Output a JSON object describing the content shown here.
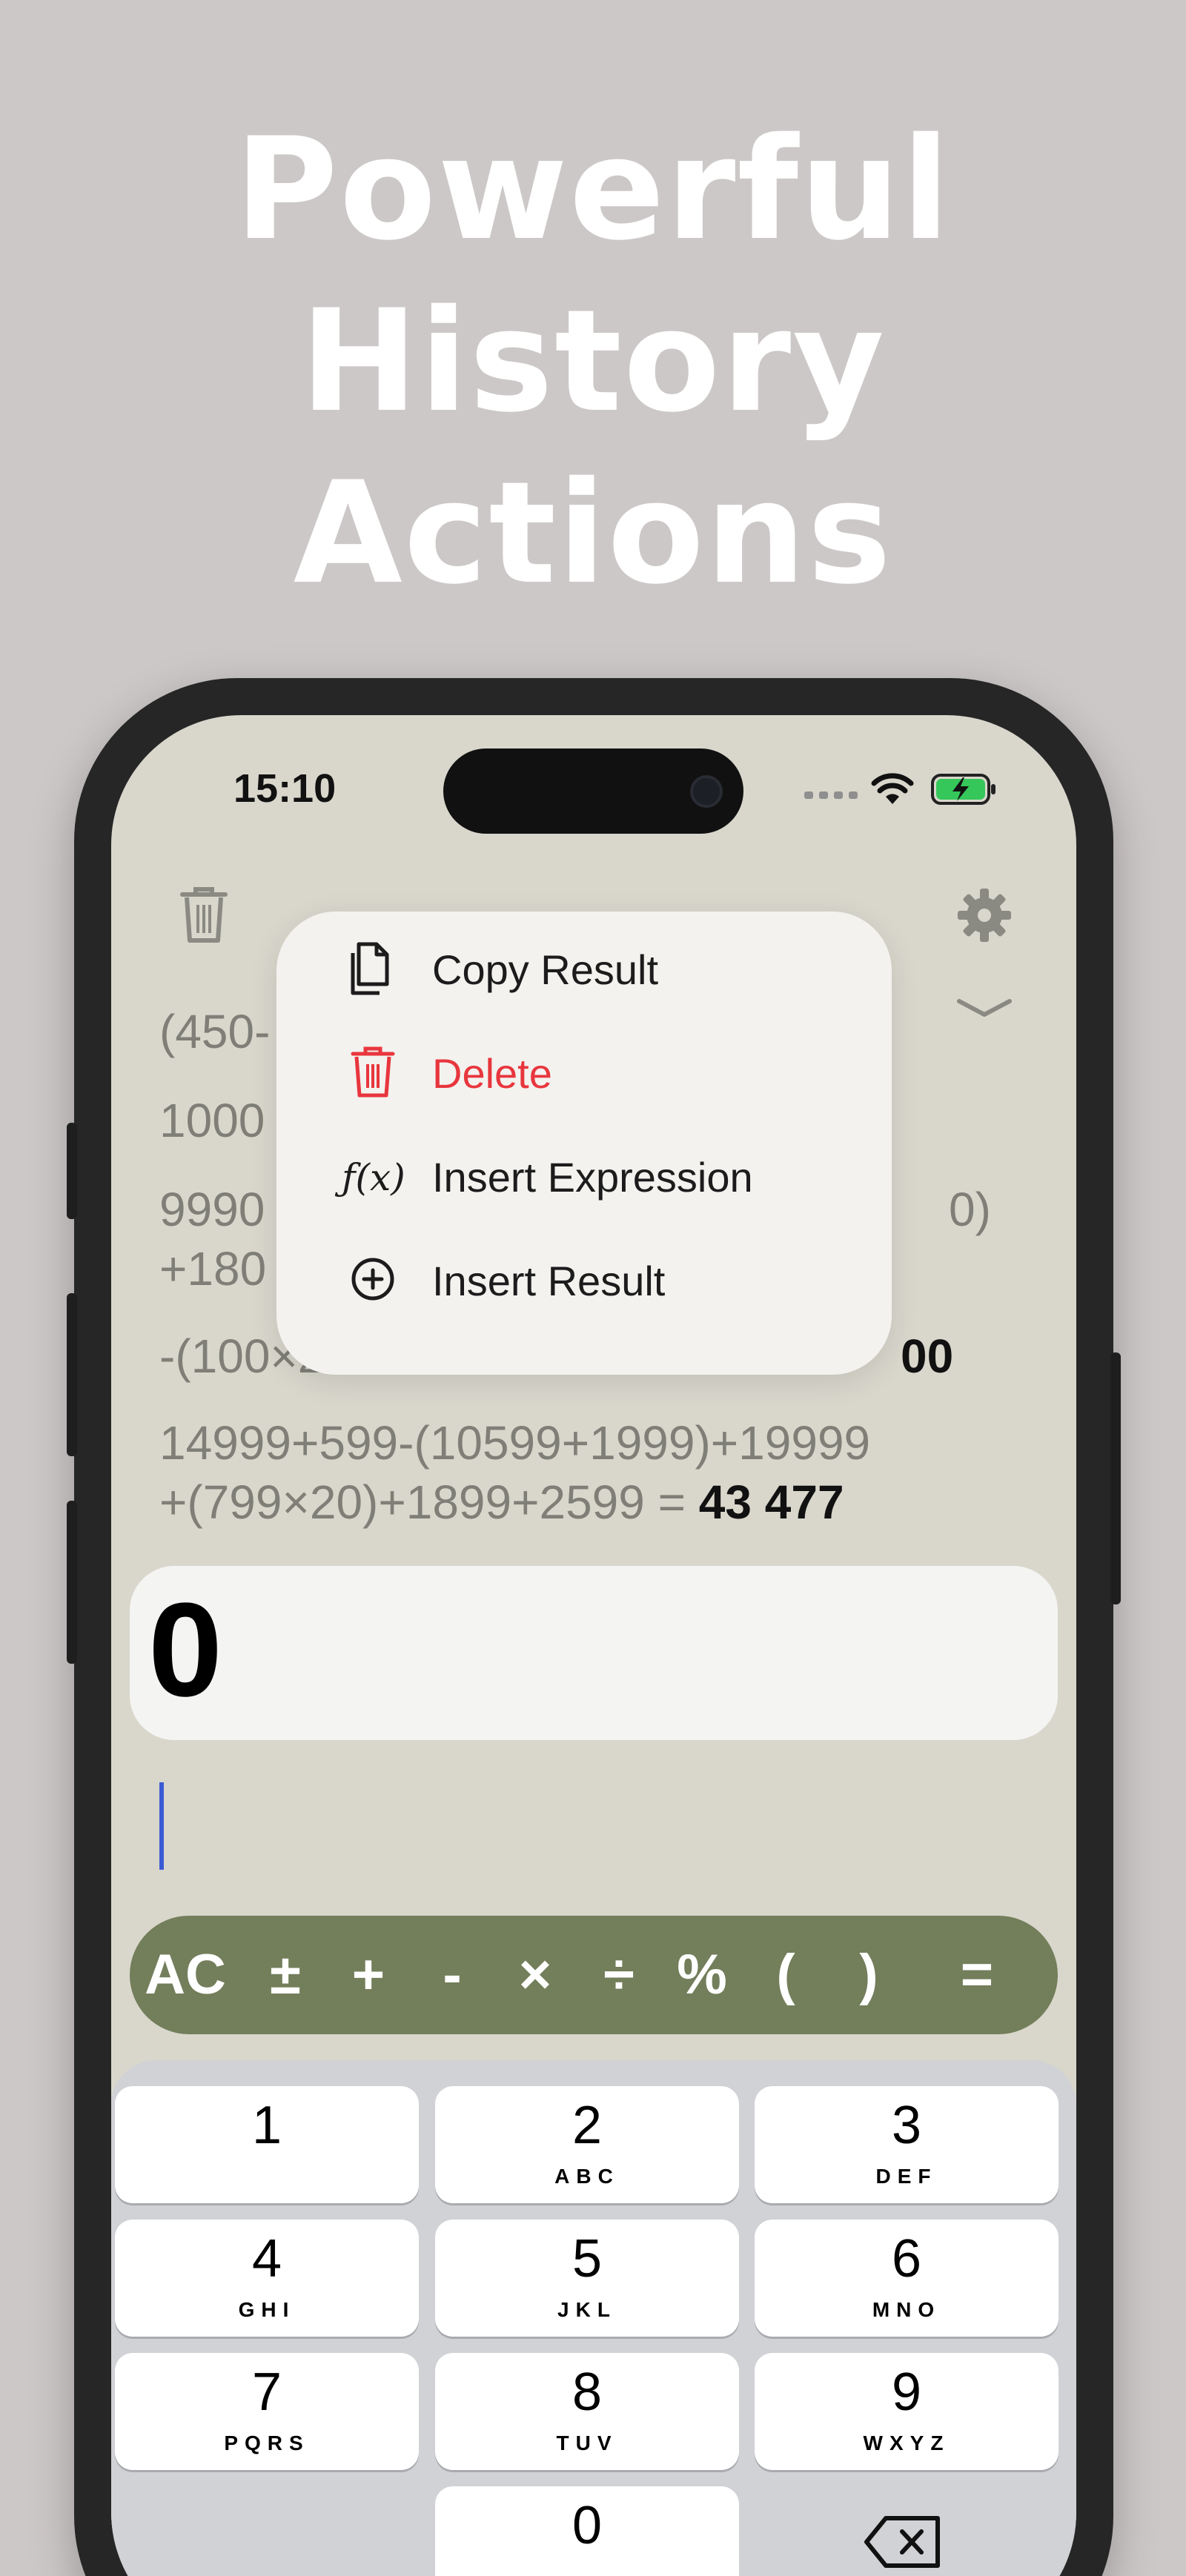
{
  "headline": [
    "Powerful",
    "History",
    "Actions"
  ],
  "status": {
    "time": "15:10"
  },
  "history": [
    {
      "expr": "(450-",
      "result": ""
    },
    {
      "expr": "1000",
      "result": ""
    },
    {
      "expr": "9990",
      "tail": "0)",
      "expr2": "+180",
      "result": ""
    },
    {
      "expr": "-(100×2",
      "result": "00"
    },
    {
      "expr": "14999+599-(10599+1999)+19999",
      "expr2": "+(799×20)+1899+2599 = ",
      "result": "43 477"
    }
  ],
  "menu": {
    "items": [
      {
        "label": "Copy Result",
        "icon": "copy-icon"
      },
      {
        "label": "Delete",
        "icon": "trash-icon"
      },
      {
        "label": "Insert Expression",
        "icon": "function-icon",
        "glyph": "ƒ(x)"
      },
      {
        "label": "Insert Result",
        "icon": "plus-circle-icon"
      }
    ]
  },
  "display": {
    "value": "0"
  },
  "operators": [
    "AC",
    "±",
    "+",
    "-",
    "×",
    "÷",
    "%",
    "(",
    ")",
    "="
  ],
  "keypad": [
    {
      "num": "1",
      "sub": ""
    },
    {
      "num": "2",
      "sub": "ABC"
    },
    {
      "num": "3",
      "sub": "DEF"
    },
    {
      "num": "4",
      "sub": "GHI"
    },
    {
      "num": "5",
      "sub": "JKL"
    },
    {
      "num": "6",
      "sub": "MNO"
    },
    {
      "num": "7",
      "sub": "PQRS"
    },
    {
      "num": "8",
      "sub": "TUV"
    },
    {
      "num": "9",
      "sub": "WXYZ"
    },
    {
      "num": "0",
      "sub": ""
    }
  ],
  "colors": {
    "background": "#cdc8c8",
    "screen": "#d9d7cc",
    "ops_bar": "#737e5b",
    "danger": "#e8363d",
    "cursor": "#3b5bd6"
  }
}
